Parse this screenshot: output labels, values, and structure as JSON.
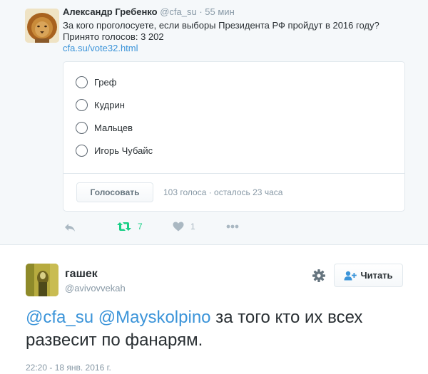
{
  "tweet1": {
    "author_name": "Александр Гребенко",
    "author_handle": "@cfa_su",
    "separator": "·",
    "time": "55 мин",
    "text_line1": "За кого проголосуете, если выборы Президента РФ пройдут в 2016 году?",
    "text_line2": "Принято голосов: 3 202",
    "link": "cfa.su/vote32.html",
    "poll": {
      "options": [
        "Греф",
        "Кудрин",
        "Мальцев",
        "Игорь Чубайс"
      ],
      "vote_button": "Голосовать",
      "stats": "103 голоса · осталось 23 часа"
    },
    "actions": {
      "retweet_count": "7",
      "like_count": "1"
    }
  },
  "tweet2": {
    "author_name": "гашек",
    "author_handle": "@avivovvekah",
    "follow_button": "Читать",
    "mention1": "@cfa_su",
    "mention2": "@Mayskolpino",
    "text_rest": " за того кто их всех развесит по фанарям.",
    "timestamp": "22:20 - 18 янв. 2016 г."
  },
  "colors": {
    "link": "#3b94d9",
    "retweet_green": "#19cf86",
    "muted": "#8899a6",
    "text": "#292f33"
  },
  "icons": [
    "reply-icon",
    "retweet-icon",
    "heart-icon",
    "more-icon",
    "gear-icon",
    "follow-person-icon"
  ]
}
